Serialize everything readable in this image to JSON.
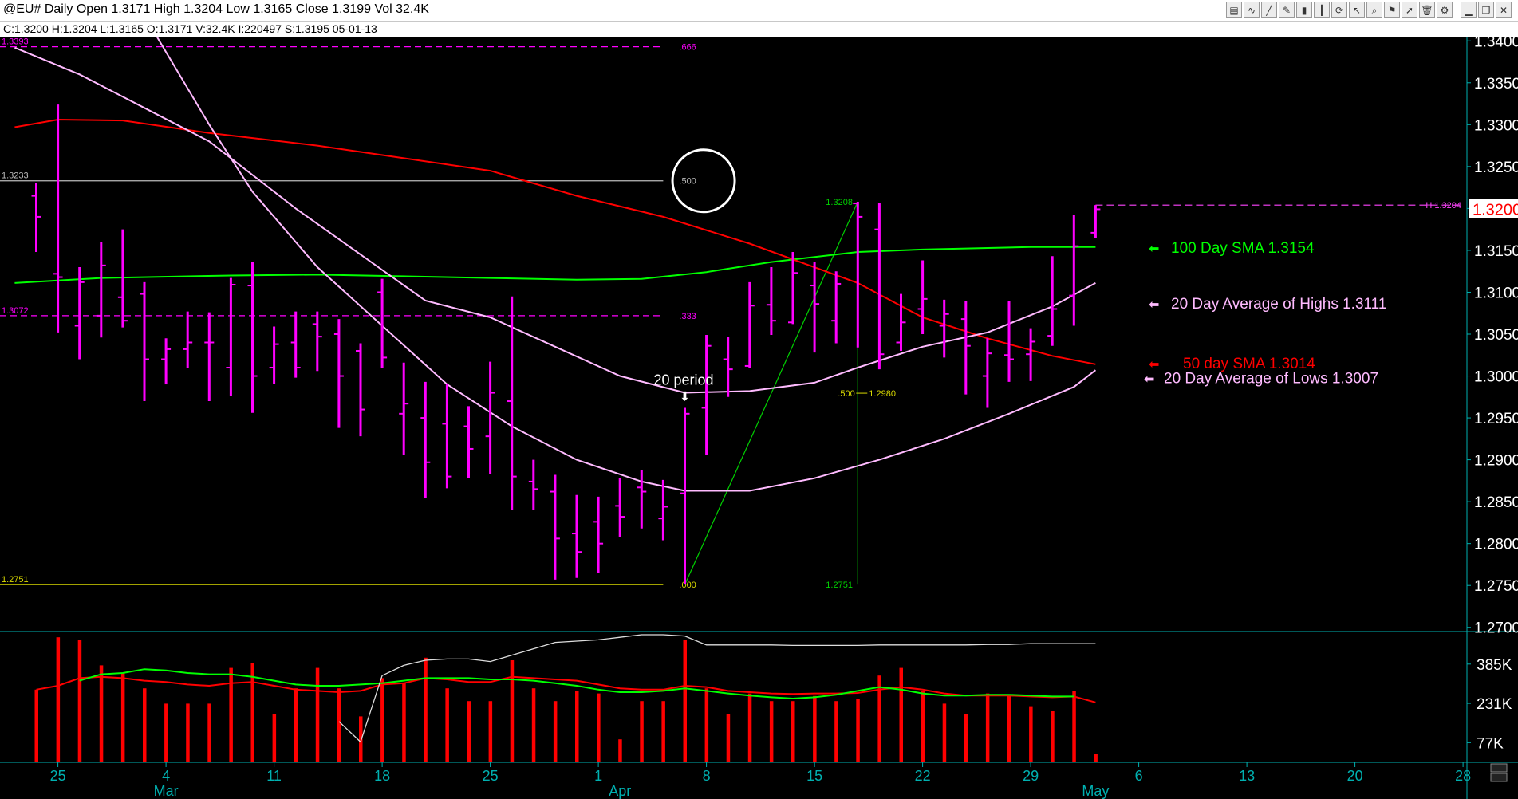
{
  "header": {
    "title": "@EU# Daily Open 1.3171 High 1.3204 Low 1.3165 Close 1.3199 Vol 32.4K",
    "info": "C:1.3200  H:1.3204  L:1.3165  O:1.3171  V:32.4K  I:220497  S:1.3195  05-01-13"
  },
  "toolbar": {
    "icons": [
      "chart-type-icon",
      "indicator-icon",
      "draw-line-icon",
      "pencil-icon",
      "bar-chart-icon",
      "candle-icon",
      "refresh-icon",
      "cursor-icon",
      "zoom-icon",
      "flag-icon",
      "arrow-icon",
      "delete-icon",
      "settings-icon",
      "minimize-icon",
      "restore-icon",
      "close-icon"
    ],
    "glyphs": [
      "▤",
      "∿",
      "╱",
      "✎",
      "▮",
      "┃",
      "⟳",
      "↖",
      "⌕",
      "⚑",
      "➚",
      "🗑",
      "⚙",
      "▁",
      "❐",
      "✕"
    ]
  },
  "colors": {
    "background": "#000000",
    "bar": "#ff00ff",
    "sma100": "#00ff00",
    "sma50": "#ff0000",
    "band": "#ffbbff",
    "fib_magenta": "#ff00ff",
    "fib_yellow": "#d8d800",
    "fib_green": "#00d000",
    "axis": "#00b0b0",
    "axis_text": "#ffffff",
    "volume_bar": "#ff0000",
    "volume_avg": "#00ff00",
    "oi_line": "#dddddd",
    "hi_line": "#ff44ff"
  },
  "chart_data": [
    {
      "type": "bar",
      "subtype": "ohlc",
      "symbol": "@EU#",
      "ylim": [
        1.2695,
        1.3405
      ],
      "y_ticks": [
        "1.3400",
        "1.3350",
        "1.3300",
        "1.3250",
        "1.3200",
        "1.3150",
        "1.3100",
        "1.3050",
        "1.3000",
        "1.2950",
        "1.2900",
        "1.2850",
        "1.2800",
        "1.2750",
        "1.2700"
      ],
      "current_price_label": "1.3200",
      "x_ticks": [
        {
          "label": "25",
          "index": 1
        },
        {
          "label": "4",
          "index": 6
        },
        {
          "label": "11",
          "index": 11
        },
        {
          "label": "18",
          "index": 16
        },
        {
          "label": "25",
          "index": 21
        },
        {
          "label": "1",
          "index": 26
        },
        {
          "label": "8",
          "index": 31
        },
        {
          "label": "15",
          "index": 36
        },
        {
          "label": "22",
          "index": 41
        },
        {
          "label": "29",
          "index": 46
        },
        {
          "label": "6",
          "index": 51
        },
        {
          "label": "13",
          "index": 56
        },
        {
          "label": "20",
          "index": 61
        },
        {
          "label": "28",
          "index": 66
        }
      ],
      "month_labels": [
        {
          "label": "Mar",
          "index": 6
        },
        {
          "label": "Apr",
          "index": 27
        },
        {
          "label": "May",
          "index": 49
        }
      ],
      "bars": [
        {
          "o": 1.3215,
          "h": 1.323,
          "l": 1.3148,
          "c": 1.319
        },
        {
          "o": 1.3122,
          "h": 1.3324,
          "l": 1.3052,
          "c": 1.3118
        },
        {
          "o": 1.306,
          "h": 1.313,
          "l": 1.302,
          "c": 1.3112
        },
        {
          "o": 1.3072,
          "h": 1.316,
          "l": 1.3046,
          "c": 1.3132
        },
        {
          "o": 1.3094,
          "h": 1.3175,
          "l": 1.3058,
          "c": 1.3066
        },
        {
          "o": 1.3098,
          "h": 1.3112,
          "l": 1.297,
          "c": 1.302
        },
        {
          "o": 1.302,
          "h": 1.3045,
          "l": 1.299,
          "c": 1.3032
        },
        {
          "o": 1.3032,
          "h": 1.3077,
          "l": 1.301,
          "c": 1.304
        },
        {
          "o": 1.304,
          "h": 1.3076,
          "l": 1.297,
          "c": 1.304
        },
        {
          "o": 1.301,
          "h": 1.3117,
          "l": 1.2976,
          "c": 1.3109
        },
        {
          "o": 1.3108,
          "h": 1.3136,
          "l": 1.2956,
          "c": 1.3
        },
        {
          "o": 1.301,
          "h": 1.3059,
          "l": 1.299,
          "c": 1.3038
        },
        {
          "o": 1.304,
          "h": 1.3077,
          "l": 1.2998,
          "c": 1.301
        },
        {
          "o": 1.3062,
          "h": 1.3077,
          "l": 1.3006,
          "c": 1.3047
        },
        {
          "o": 1.305,
          "h": 1.3068,
          "l": 1.2938,
          "c": 1.3
        },
        {
          "o": 1.303,
          "h": 1.3039,
          "l": 1.2928,
          "c": 1.296
        },
        {
          "o": 1.31,
          "h": 1.3116,
          "l": 1.301,
          "c": 1.3022
        },
        {
          "o": 1.2955,
          "h": 1.3016,
          "l": 1.2906,
          "c": 1.2967
        },
        {
          "o": 1.295,
          "h": 1.2993,
          "l": 1.2854,
          "c": 1.2897
        },
        {
          "o": 1.2943,
          "h": 1.299,
          "l": 1.2866,
          "c": 1.288
        },
        {
          "o": 1.294,
          "h": 1.2964,
          "l": 1.2878,
          "c": 1.2913
        },
        {
          "o": 1.2928,
          "h": 1.3017,
          "l": 1.2883,
          "c": 1.298
        },
        {
          "o": 1.297,
          "h": 1.3095,
          "l": 1.284,
          "c": 1.288
        },
        {
          "o": 1.2874,
          "h": 1.29,
          "l": 1.284,
          "c": 1.2865
        },
        {
          "o": 1.2862,
          "h": 1.2882,
          "l": 1.2757,
          "c": 1.2806
        },
        {
          "o": 1.2812,
          "h": 1.2858,
          "l": 1.2759,
          "c": 1.279
        },
        {
          "o": 1.2826,
          "h": 1.2856,
          "l": 1.2765,
          "c": 1.28
        },
        {
          "o": 1.2845,
          "h": 1.2878,
          "l": 1.2808,
          "c": 1.2832
        },
        {
          "o": 1.2867,
          "h": 1.2888,
          "l": 1.2818,
          "c": 1.2862
        },
        {
          "o": 1.283,
          "h": 1.2876,
          "l": 1.2804,
          "c": 1.2844
        },
        {
          "o": 1.286,
          "h": 1.2962,
          "l": 1.2751,
          "c": 1.2955
        },
        {
          "o": 1.2962,
          "h": 1.3049,
          "l": 1.2906,
          "c": 1.3036
        },
        {
          "o": 1.302,
          "h": 1.3047,
          "l": 1.2975,
          "c": 1.3008
        },
        {
          "o": 1.3012,
          "h": 1.3112,
          "l": 1.301,
          "c": 1.3084
        },
        {
          "o": 1.3085,
          "h": 1.313,
          "l": 1.3049,
          "c": 1.3066
        },
        {
          "o": 1.3064,
          "h": 1.3148,
          "l": 1.3062,
          "c": 1.3123
        },
        {
          "o": 1.3108,
          "h": 1.3136,
          "l": 1.3028,
          "c": 1.3086
        },
        {
          "o": 1.3066,
          "h": 1.3125,
          "l": 1.3039,
          "c": 1.311
        },
        {
          "o": 1.3206,
          "h": 1.3208,
          "l": 1.3034,
          "c": 1.319
        },
        {
          "o": 1.3175,
          "h": 1.3207,
          "l": 1.3008,
          "c": 1.3026
        },
        {
          "o": 1.304,
          "h": 1.3098,
          "l": 1.303,
          "c": 1.3064
        },
        {
          "o": 1.308,
          "h": 1.3138,
          "l": 1.305,
          "c": 1.3092
        },
        {
          "o": 1.306,
          "h": 1.3091,
          "l": 1.3022,
          "c": 1.3074
        },
        {
          "o": 1.3068,
          "h": 1.3089,
          "l": 1.2978,
          "c": 1.3036
        },
        {
          "o": 1.3,
          "h": 1.3045,
          "l": 1.2962,
          "c": 1.3027
        },
        {
          "o": 1.3025,
          "h": 1.309,
          "l": 1.2993,
          "c": 1.302
        },
        {
          "o": 1.3026,
          "h": 1.3057,
          "l": 1.2994,
          "c": 1.3041
        },
        {
          "o": 1.3048,
          "h": 1.3143,
          "l": 1.3036,
          "c": 1.308
        },
        {
          "o": 1.3096,
          "h": 1.3192,
          "l": 1.306,
          "c": 1.3155
        },
        {
          "o": 1.3171,
          "h": 1.3204,
          "l": 1.3165,
          "c": 1.3199
        }
      ],
      "series": [
        {
          "name": "100 Day SMA",
          "value_label": "1.3154",
          "color": "#00ff00",
          "points": [
            [
              -1,
              1.3111
            ],
            [
              3,
              1.3117
            ],
            [
              9,
              1.312
            ],
            [
              13,
              1.3121
            ],
            [
              21,
              1.3117
            ],
            [
              25,
              1.3115
            ],
            [
              28,
              1.3116
            ],
            [
              31,
              1.3124
            ],
            [
              34,
              1.3136
            ],
            [
              38,
              1.3148
            ],
            [
              41,
              1.3151
            ],
            [
              46,
              1.3154
            ],
            [
              49,
              1.3154
            ]
          ]
        },
        {
          "name": "50 day SMA",
          "value_label": "1.3014",
          "color": "#ff0000",
          "points": [
            [
              -1,
              1.3297
            ],
            [
              1,
              1.3306
            ],
            [
              4,
              1.3305
            ],
            [
              8,
              1.329
            ],
            [
              13,
              1.3275
            ],
            [
              17,
              1.326
            ],
            [
              21,
              1.3245
            ],
            [
              25,
              1.3215
            ],
            [
              29,
              1.319
            ],
            [
              33,
              1.3158
            ],
            [
              38,
              1.3111
            ],
            [
              41,
              1.307
            ],
            [
              44,
              1.3045
            ],
            [
              47,
              1.3024
            ],
            [
              49,
              1.3014
            ]
          ]
        },
        {
          "name": "20 Day Average of Highs",
          "value_label": "1.3111",
          "color": "#ffbbff",
          "points": [
            [
              -1,
              1.3392
            ],
            [
              2,
              1.336
            ],
            [
              5,
              1.332
            ],
            [
              8,
              1.328
            ],
            [
              12,
              1.32
            ],
            [
              15,
              1.3145
            ],
            [
              18,
              1.309
            ],
            [
              21,
              1.307
            ],
            [
              24,
              1.3035
            ],
            [
              27,
              1.3
            ],
            [
              30,
              1.298
            ],
            [
              33,
              1.2982
            ],
            [
              36,
              1.2992
            ],
            [
              38,
              1.301
            ],
            [
              41,
              1.3035
            ],
            [
              44,
              1.3052
            ],
            [
              47,
              1.3083
            ],
            [
              49,
              1.3111
            ]
          ]
        },
        {
          "name": "20 Day Average of Lows",
          "value_label": "1.3007",
          "color": "#ffbbff",
          "points": [
            [
              5,
              1.343
            ],
            [
              8,
              1.33
            ],
            [
              10,
              1.322
            ],
            [
              13,
              1.313
            ],
            [
              16,
              1.306
            ],
            [
              19,
              1.299
            ],
            [
              22,
              1.294
            ],
            [
              25,
              1.29
            ],
            [
              28,
              1.2874
            ],
            [
              30,
              1.2863
            ],
            [
              33,
              1.2863
            ],
            [
              36,
              1.2878
            ],
            [
              39,
              1.29
            ],
            [
              42,
              1.2925
            ],
            [
              45,
              1.2955
            ],
            [
              48,
              1.2987
            ],
            [
              49,
              1.3007
            ]
          ]
        }
      ],
      "fibonacci": [
        {
          "labels": [
            "1.3393",
            ".666"
          ],
          "price": 1.3393,
          "color": "#ff00ff",
          "style": "dashed",
          "from": -1,
          "to": 29
        },
        {
          "labels": [
            "1.3233",
            ".500"
          ],
          "price": 1.3233,
          "color": "#bbbbbb",
          "style": "solid",
          "from": -1,
          "to": 29
        },
        {
          "labels": [
            "1.3072",
            ".333"
          ],
          "price": 1.3072,
          "color": "#ff00ff",
          "style": "dashed",
          "from": -1,
          "to": 29
        },
        {
          "labels": [
            "1.2751",
            ".000"
          ],
          "price": 1.2751,
          "color": "#d8d800",
          "style": "solid",
          "from": -1,
          "to": 29
        }
      ],
      "fib_retracement": {
        "low": 1.2751,
        "high": 1.3208,
        "low_label": "1.2751",
        "high_label": "1.3208",
        "mid_label": ".500",
        "mid_value": "1.2980",
        "low_index": 30,
        "high_index": 38
      },
      "high_line": {
        "price": 1.3204,
        "label": "H 1.3204",
        "from_index": 49
      },
      "annotations": {
        "circle_index": 30.5,
        "circle_price": 1.3233,
        "period_label": "20 period",
        "period_arrow": "⬇",
        "period_index": 30,
        "period_price": 1.2963
      },
      "legend": [
        {
          "arrow": "⬅",
          "text": "100 Day SMA 1.3154",
          "color": "#00ff00",
          "price": 1.3153
        },
        {
          "arrow": "⬅",
          "text": "20 Day Average of Highs  1.3111",
          "color": "#ffbbff",
          "price": 1.3086
        },
        {
          "arrow": "⬅",
          "text": "50 day SMA  1.3014",
          "color": "#ff0000",
          "price": 1.3015
        },
        {
          "arrow": "⬅",
          "text": "20 Day Average of Lows   1.3007",
          "color": "#ffbbff",
          "price": 1.2997
        }
      ]
    },
    {
      "type": "bar",
      "subtype": "volume",
      "ylim": [
        0,
        500000
      ],
      "y_ticks": [
        {
          "label": "385K",
          "value": 385000
        },
        {
          "label": "231K",
          "value": 231000
        },
        {
          "label": "77K",
          "value": 77000
        }
      ],
      "volume": [
        285000,
        490000,
        480000,
        380000,
        350000,
        290000,
        230000,
        230000,
        230000,
        370000,
        390000,
        190000,
        290000,
        370000,
        290000,
        180000,
        330000,
        310000,
        410000,
        290000,
        240000,
        240000,
        400000,
        290000,
        240000,
        280000,
        270000,
        90000,
        240000,
        240000,
        480000,
        290000,
        190000,
        270000,
        240000,
        240000,
        260000,
        240000,
        250000,
        340000,
        370000,
        280000,
        230000,
        190000,
        270000,
        260000,
        220000,
        200000,
        280000,
        32000
      ],
      "series": [
        {
          "name": "volume-avg-red",
          "color": "#ff0000",
          "values": [
            285000,
            300000,
            330000,
            335000,
            330000,
            320000,
            315000,
            305000,
            300000,
            310000,
            315000,
            300000,
            285000,
            280000,
            275000,
            280000,
            305000,
            310000,
            330000,
            325000,
            315000,
            315000,
            335000,
            330000,
            325000,
            320000,
            305000,
            290000,
            285000,
            285000,
            300000,
            295000,
            280000,
            275000,
            270000,
            268000,
            270000,
            270000,
            272000,
            285000,
            295000,
            285000,
            270000,
            262000,
            262000,
            262000,
            258000,
            255000,
            258000,
            235000
          ]
        },
        {
          "name": "volume-avg-green",
          "color": "#00ff00",
          "values": [
            null,
            null,
            320000,
            345000,
            350000,
            365000,
            360000,
            350000,
            345000,
            345000,
            335000,
            320000,
            305000,
            300000,
            300000,
            305000,
            310000,
            320000,
            330000,
            330000,
            330000,
            325000,
            325000,
            320000,
            310000,
            300000,
            285000,
            275000,
            275000,
            280000,
            290000,
            280000,
            270000,
            262000,
            255000,
            250000,
            255000,
            265000,
            280000,
            295000,
            285000,
            270000,
            262000,
            262000,
            265000,
            265000,
            262000,
            258000,
            258000,
            null
          ]
        },
        {
          "name": "open-interest",
          "color": "#dddddd",
          "values": [
            null,
            null,
            null,
            null,
            null,
            null,
            null,
            null,
            null,
            null,
            null,
            null,
            null,
            null,
            160000,
            80000,
            340000,
            380000,
            400000,
            405000,
            405000,
            395000,
            420000,
            445000,
            470000,
            475000,
            480000,
            490000,
            500000,
            500000,
            495000,
            460000,
            460000,
            460000,
            460000,
            458000,
            458000,
            458000,
            458000,
            460000,
            460000,
            460000,
            460000,
            460000,
            462000,
            462000,
            465000,
            465000,
            465000,
            465000
          ]
        }
      ]
    }
  ]
}
